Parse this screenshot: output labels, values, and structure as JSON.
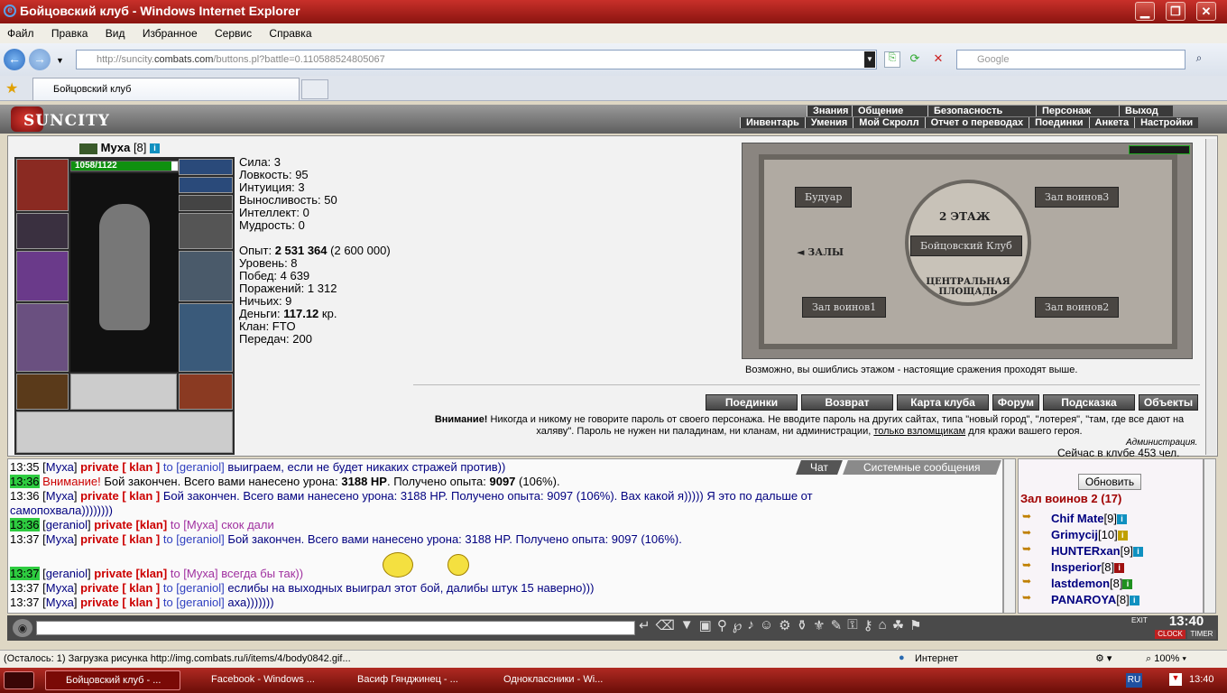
{
  "window": {
    "title": "Бойцовский клуб - Windows Internet Explorer"
  },
  "menubar": [
    "Файл",
    "Правка",
    "Вид",
    "Избранное",
    "Сервис",
    "Справка"
  ],
  "address": {
    "prefix": "http://suncity.",
    "domain": "combats.com",
    "suffix": "/buttons.pl?battle=0.110588524805067",
    "search_placeholder": "Google"
  },
  "tab": {
    "title": "Бойцовский клуб"
  },
  "game": {
    "logo": "SUNCITY",
    "menu_top": [
      "Знания",
      "Общение",
      "Безопасность",
      "Персонаж",
      "Выход"
    ],
    "menu_bottom": [
      "Инвентарь",
      "Умения",
      "Мой Скролл",
      "Отчет о переводах",
      "Поединки",
      "Анкета",
      "Настройки"
    ],
    "character": {
      "name": "Муха",
      "level": "[8]",
      "hp": "1058/1122"
    },
    "stats": [
      {
        "label": "Сила:",
        "value": "3"
      },
      {
        "label": "Ловкость:",
        "value": "95"
      },
      {
        "label": "Интуиция:",
        "value": "3"
      },
      {
        "label": "Выносливость:",
        "value": "50"
      },
      {
        "label": "Интеллект:",
        "value": "0"
      },
      {
        "label": "Мудрость:",
        "value": "0"
      }
    ],
    "exp_label": "Опыт:",
    "exp_value": "2 531 364",
    "exp_next": "(2 600 000)",
    "level_line": "Уровень: 8",
    "wins": "Побед: 4 639",
    "losses": "Поражений: 1 312",
    "draws": "Ничьих: 9",
    "money_label": "Деньги:",
    "money_value": "117.12",
    "money_unit": "кр.",
    "clan": "Клан: FTO",
    "transfers": "Передач: 200",
    "map": {
      "floor": "2 ЭТАЖ",
      "club": "Бойцовский Клуб",
      "boudoir": "Будуар",
      "hall3": "Зал воинов3",
      "halls": "ЗАЛЫ",
      "central": "ЦЕНТРАЛЬНАЯ ПЛОЩАДЬ",
      "hall1": "Зал воинов1",
      "hall2": "Зал воинов2"
    },
    "map_note": "Возможно, вы ошиблись этажом - настоящие сражения проходят выше.",
    "buttons": [
      "Поединки",
      "Возврат",
      "Карта клуба",
      "Форум",
      "Подсказка",
      "Объекты"
    ],
    "warning_bold": "Внимание!",
    "warning_text": "Никогда и никому не говорите пароль от своего персонажа. Не вводите пароль на других сайтах, типа \"новый город\", \"лотерея\", \"там, где все дают на халяву\". Пароль не нужен ни паладинам, ни кланам, ни администрации,",
    "warning_link": "только взломщикам",
    "warning_tail": "для кражи вашего героя.",
    "admin": "Администрация.",
    "online": "Сейчас в клубе 453 чел."
  },
  "chat_tabs": [
    "Чат",
    "Системные сообщения"
  ],
  "chat": [
    {
      "time": "13:35",
      "nick": "Муха",
      "priv": "private [ klan ]",
      "to": "to [geraniol]",
      "text": "выиграем, если не будет никаких стражей против))"
    },
    {
      "time": "13:36",
      "warn": "Внимание!",
      "text1": "Бой закончен. Всего вами нанесено урона:",
      "dmg": "3188 HP",
      "text2": ". Получено опыта:",
      "xp": "9097",
      "text3": "(106%)."
    },
    {
      "time": "13:36",
      "nick": "Муха",
      "priv": "private [ klan ]",
      "text": "Бой закончен. Всего вами нанесено урона: 3188 HP. Получено опыта: 9097 (106%). Вах какой я))))) Я это по дальше от",
      "cont": "самопохвала))))))))"
    },
    {
      "time": "13:36",
      "nick": "geraniol",
      "priv": "private [klan]",
      "to": "to [Муха]",
      "text": "скок дали"
    },
    {
      "time": "13:37",
      "nick": "Муха",
      "priv": "private [ klan ]",
      "to": "to [geraniol]",
      "text": "Бой закончен. Всего вами нанесено урона: 3188 HP. Получено опыта: 9097 (106%)."
    },
    {
      "time": "13:37",
      "nick": "geraniol",
      "priv": "private [klan]",
      "to": "to [Муха]",
      "text": "всегда бы так))"
    },
    {
      "time": "13:37",
      "nick": "Муха",
      "priv": "private [ klan ]",
      "to": "to [geraniol]",
      "text": "еслибы на выходных выиграл этот бой, далибы штук 15 наверно)))"
    },
    {
      "time": "13:37",
      "nick": "Муха",
      "priv": "private [ klan ]",
      "to": "to [geraniol]",
      "text": "аха)))))))"
    }
  ],
  "side": {
    "refresh": "Обновить",
    "room": "Зал воинов 2 (17)",
    "users": [
      {
        "name": "Chif Mate",
        "lvl": "[9]"
      },
      {
        "name": "Grimycij",
        "lvl": "[10]"
      },
      {
        "name": "HUNTERxan",
        "lvl": "[9]"
      },
      {
        "name": "Insperior",
        "lvl": "[8]"
      },
      {
        "name": "lastdemon",
        "lvl": "[8]"
      },
      {
        "name": "PANAROYA",
        "lvl": "[8]"
      }
    ]
  },
  "clock": {
    "time": "13:40",
    "clock": "CLOCK",
    "timer": "TIMER",
    "exit": "EXIT"
  },
  "status": {
    "text": "(Осталось: 1) Загрузка рисунка http://img.combats.ru/i/items/4/body0842.gif...",
    "zone": "Интернет",
    "zoom": "100%"
  },
  "taskbar": {
    "items": [
      "Бойцовский клуб - ...",
      "Facebook - Windows ...",
      "Васиф Гянджинец - ...",
      "Одноклассники - Wi..."
    ],
    "lang": "RU",
    "time": "13:40"
  },
  "colors": {
    "title": "#b02a22",
    "accent": "#2ecc40"
  }
}
